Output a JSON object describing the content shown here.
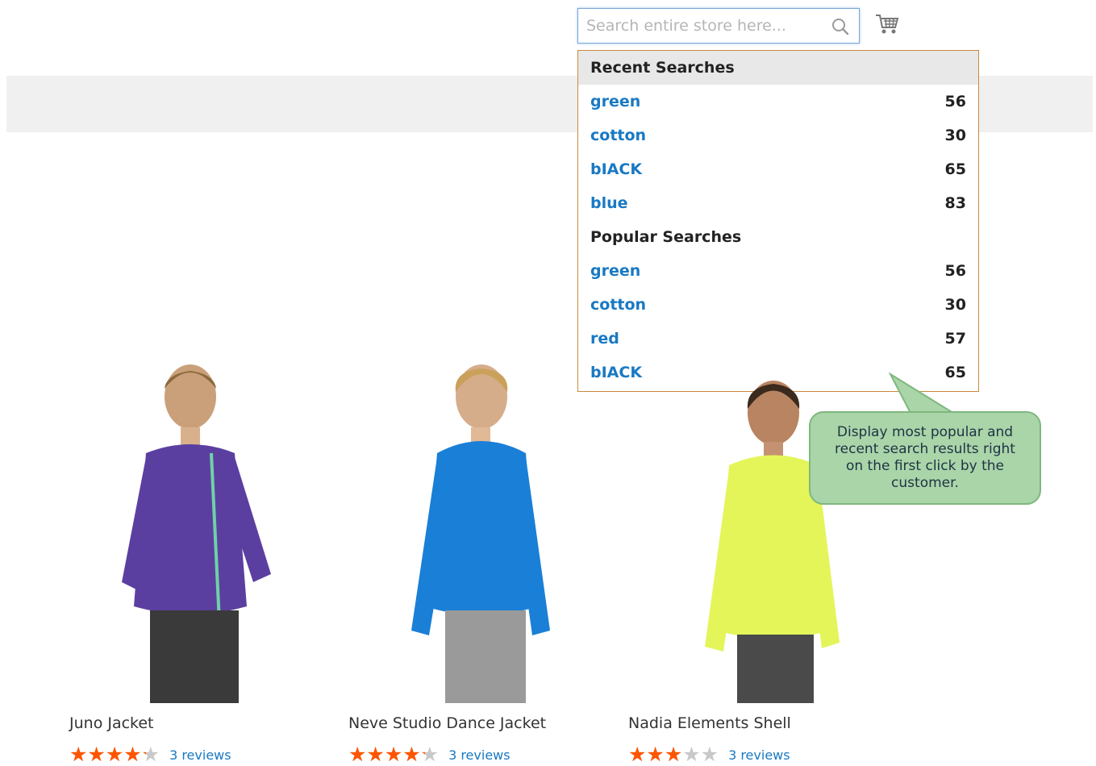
{
  "search": {
    "placeholder": "Search entire store here...",
    "value": ""
  },
  "dropdown": {
    "recent_title": "Recent Searches",
    "recent": [
      {
        "term": "green",
        "count": "56"
      },
      {
        "term": "cotton",
        "count": "30"
      },
      {
        "term": "bIACK",
        "count": "65"
      },
      {
        "term": "blue",
        "count": "83"
      }
    ],
    "popular_title": "Popular Searches",
    "popular": [
      {
        "term": "green",
        "count": "56"
      },
      {
        "term": "cotton",
        "count": "30"
      },
      {
        "term": "red",
        "count": "57"
      },
      {
        "term": "bIACK",
        "count": "65"
      }
    ]
  },
  "callout": {
    "text": "Display most popular and recent search results right on the first click by the customer."
  },
  "products": [
    {
      "name": "Juno Jacket",
      "rating_fraction": 0.85,
      "reviews": "3 reviews",
      "color": "#5b3fa0"
    },
    {
      "name": "Neve Studio Dance Jacket",
      "rating_fraction": 0.85,
      "reviews": "3 reviews",
      "color": "#1a7fd6"
    },
    {
      "name": "Nadia Elements Shell",
      "rating_fraction": 0.6,
      "reviews": "3 reviews",
      "color": "#e4f55a"
    }
  ],
  "icons": {
    "search": "magnifier-icon",
    "cart": "shopping-cart-icon"
  },
  "colors": {
    "link": "#1979c3",
    "star": "#ff5501",
    "callout": "#a9d5a9",
    "dropdown_border": "#c98a3c"
  }
}
